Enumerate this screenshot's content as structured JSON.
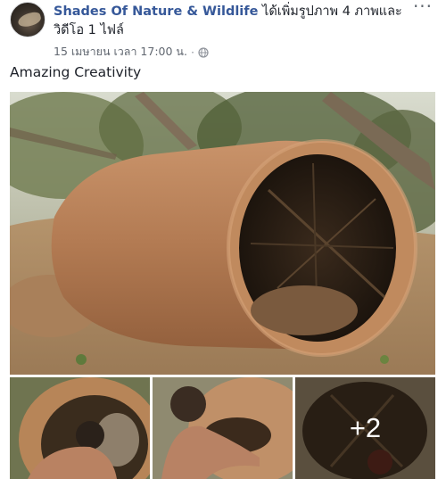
{
  "post": {
    "page_name": "Shades Of Nature & Wildlife",
    "action_text": " ได้เพิ่มรูปภาพ 4 ภาพและวิดีโอ 1 ไฟล์",
    "timestamp": "15 เมษายน เวลา 17:00 น.",
    "separator": "·",
    "privacy_icon": "globe-icon",
    "more_label": "···",
    "caption": "Amazing Creativity",
    "more_photos_overlay": "+2"
  },
  "colors": {
    "link": "#365899",
    "text": "#1d2129",
    "meta": "#616770"
  }
}
